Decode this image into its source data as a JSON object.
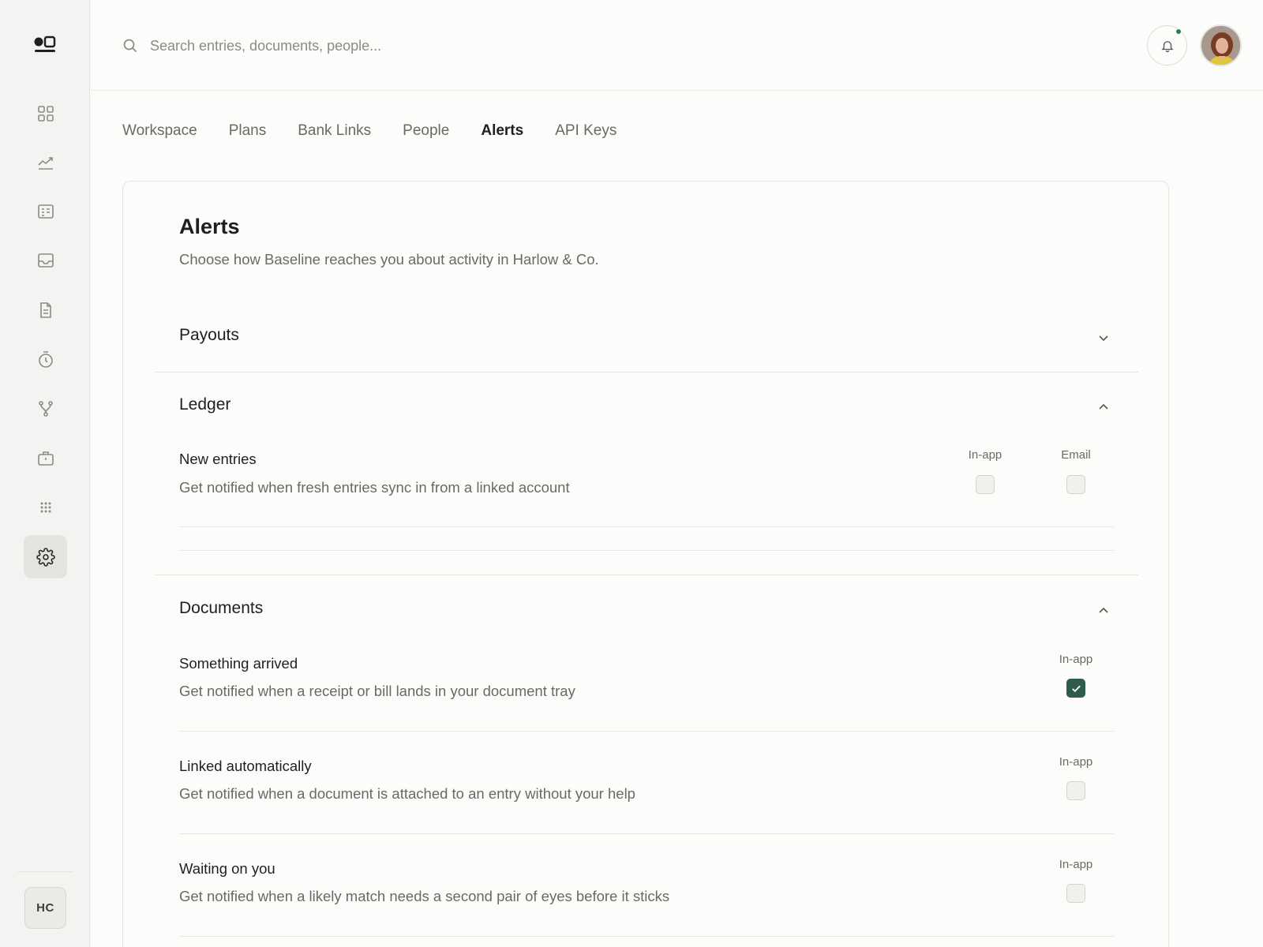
{
  "search": {
    "placeholder": "Search entries, documents, people..."
  },
  "user": {
    "initials": "HC"
  },
  "icons": {
    "nav": [
      "grid-icon",
      "trend-chart-icon",
      "ledger-icon",
      "inbox-icon",
      "document-icon",
      "timer-icon",
      "branch-icon",
      "briefcase-icon",
      "apps-dots-icon",
      "gear-icon"
    ],
    "accent": "#2f5b4b",
    "status_dot": "#2e7d5b"
  },
  "tabs": [
    {
      "label": "Workspace"
    },
    {
      "label": "Plans"
    },
    {
      "label": "Bank Links"
    },
    {
      "label": "People"
    },
    {
      "label": "Alerts",
      "active": true
    },
    {
      "label": "API Keys"
    }
  ],
  "card": {
    "title": "Alerts",
    "subtitle": "Choose how Baseline reaches you about activity in Harlow & Co."
  },
  "sections": {
    "payouts": {
      "title": "Payouts",
      "expanded": false
    },
    "ledger": {
      "title": "Ledger",
      "expanded": true,
      "items": [
        {
          "title": "New entries",
          "desc": "Get notified when fresh entries sync in from a linked account",
          "in_app_label": "In-app",
          "email_label": "Email",
          "in_app": false,
          "email": false
        }
      ]
    },
    "documents": {
      "title": "Documents",
      "expanded": true,
      "items": [
        {
          "title": "Something arrived",
          "desc": "Get notified when a receipt or bill lands in your document tray",
          "in_app_label": "In-app",
          "in_app": true
        },
        {
          "title": "Linked automatically",
          "desc": "Get notified when a document is attached to an entry without your help",
          "in_app_label": "In-app",
          "in_app": false
        },
        {
          "title": "Waiting on you",
          "desc": "Get notified when a likely match needs a second pair of eyes before it sticks",
          "in_app_label": "In-app",
          "in_app": false
        }
      ]
    }
  }
}
